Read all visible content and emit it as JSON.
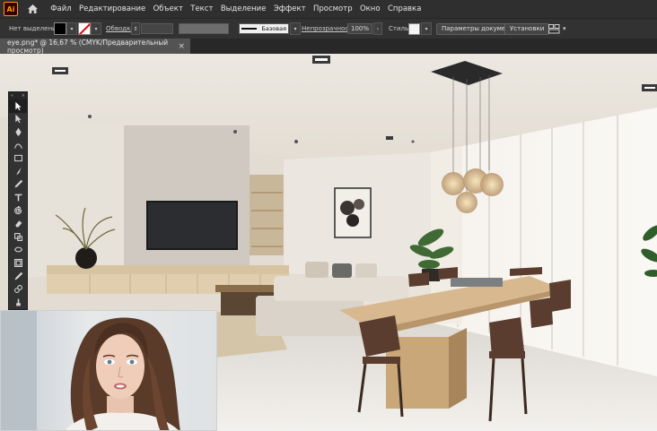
{
  "app": {
    "name": "Adobe Illustrator",
    "logo_text": "Ai",
    "accent": "#ff9a00"
  },
  "menu": {
    "items": [
      "Файл",
      "Редактирование",
      "Объект",
      "Текст",
      "Выделение",
      "Эффект",
      "Просмотр",
      "Окно",
      "Справка"
    ]
  },
  "control_bar": {
    "selection_status": "Нет выделения",
    "stroke_label": "Обводка:",
    "stroke_profile": "Базовая",
    "opacity_label": "Непрозрачность:",
    "opacity_value": "100%",
    "style_label": "Стиль:",
    "document_setup_button": "Параметры документа",
    "preferences_button": "Установки"
  },
  "document_tab": {
    "title": "eye.png* @ 16,67 % (CMYK/Предварительный просмотр)",
    "close_glyph": "×"
  },
  "tools": [
    "selection-tool",
    "direct-selection-tool",
    "pen-tool",
    "curvature-tool",
    "rectangle-tool",
    "paintbrush-tool",
    "pencil-tool",
    "type-tool",
    "rotate-tool",
    "eraser-tool",
    "scale-tool",
    "width-tool",
    "free-transform-tool",
    "eyedropper-tool",
    "blend-tool",
    "symbol-sprayer-tool",
    "artboard-tool",
    "slice-tool",
    "hand-tool",
    "zoom-tool"
  ],
  "canvas": {
    "content": "interior render: living room with TV wall and dining table with pendant lamp",
    "webcam_overlay": "presenter video"
  }
}
